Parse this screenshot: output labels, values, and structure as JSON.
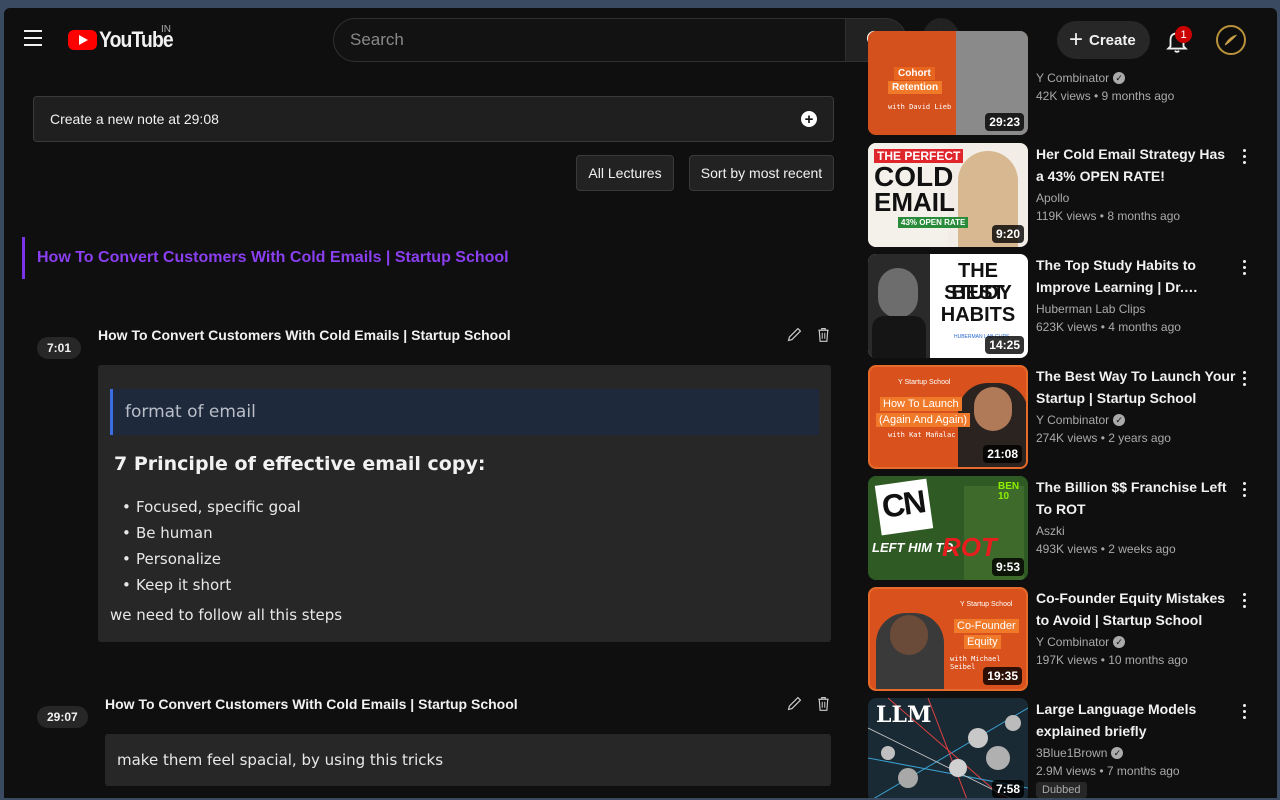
{
  "header": {
    "logo_text": "YouTube",
    "country": "IN",
    "search_placeholder": "Search",
    "create_label": "Create",
    "notification_count": "1"
  },
  "notes": {
    "new_note_label": "Create a new note at 29:08",
    "all_lectures_label": "All Lectures",
    "sort_label": "Sort by most recent",
    "lecture_title": "How To Convert Customers With Cold Emails | Startup School",
    "items": [
      {
        "timestamp": "7:01",
        "title": "How To Convert Customers With Cold Emails | Startup School",
        "quote": "format of email",
        "heading": "7 Principle of effective email copy:",
        "bullets": [
          "Focused, specific goal",
          "Be human",
          "Personalize",
          "Keep it short"
        ],
        "paragraph": "we need to follow all this steps"
      },
      {
        "timestamp": "29:07",
        "title": "How To Convert Customers With Cold Emails | Startup School",
        "text": "make them feel spacial, by using this tricks"
      }
    ]
  },
  "recommendations": [
    {
      "title": "",
      "channel": "Y Combinator",
      "verified": true,
      "meta": "42K views • 9 months ago",
      "duration": "29:23",
      "thumb_texts": [
        "Cohort",
        "Retention",
        "with David Lieb"
      ]
    },
    {
      "title": "Her Cold Email Strategy Has a 43% OPEN RATE!",
      "channel": "Apollo",
      "verified": false,
      "meta": "119K views • 8 months ago",
      "duration": "9:20",
      "thumb_texts": [
        "THE PERFECT",
        "COLD",
        "EMAIL",
        "43% OPEN RATE"
      ]
    },
    {
      "title": "The Top Study Habits to Improve Learning | Dr. Andrew Huberman",
      "channel": "Huberman Lab Clips",
      "verified": false,
      "meta": "623K views • 4 months ago",
      "duration": "14:25",
      "thumb_texts": [
        "THE BEST",
        "STUDY",
        "HABITS",
        "HUBERMAN LAB CLIPS"
      ]
    },
    {
      "title": "The Best Way To Launch Your Startup | Startup School",
      "channel": "Y Combinator",
      "verified": true,
      "meta": "274K views • 2 years ago",
      "duration": "21:08",
      "thumb_texts": [
        "Y Startup School",
        "How To Launch",
        "(Again And Again)",
        "with Kat Mañalac"
      ]
    },
    {
      "title": "The Billion $$ Franchise Left To ROT",
      "channel": "Aszki",
      "verified": false,
      "meta": "493K views • 2 weeks ago",
      "duration": "9:53",
      "thumb_texts": [
        "CN",
        "BEN 10",
        "LEFT HIM TO",
        "ROT"
      ]
    },
    {
      "title": "Co-Founder Equity Mistakes to Avoid | Startup School",
      "channel": "Y Combinator",
      "verified": true,
      "meta": "197K views • 10 months ago",
      "duration": "19:35",
      "thumb_texts": [
        "Y Startup School",
        "Co-Founder",
        "Equity",
        "with Michael Seibel"
      ]
    },
    {
      "title": "Large Language Models explained briefly",
      "channel": "3Blue1Brown",
      "verified": true,
      "meta": "2.9M views • 7 months ago",
      "duration": "7:58",
      "badge": "Dubbed",
      "thumb_texts": [
        "LLM"
      ]
    }
  ],
  "colors": {
    "brand_red": "#ff0000",
    "lecture_accent": "#8a3ff0",
    "quote_accent": "#3b6ce0",
    "background": "#0f0f0f"
  }
}
